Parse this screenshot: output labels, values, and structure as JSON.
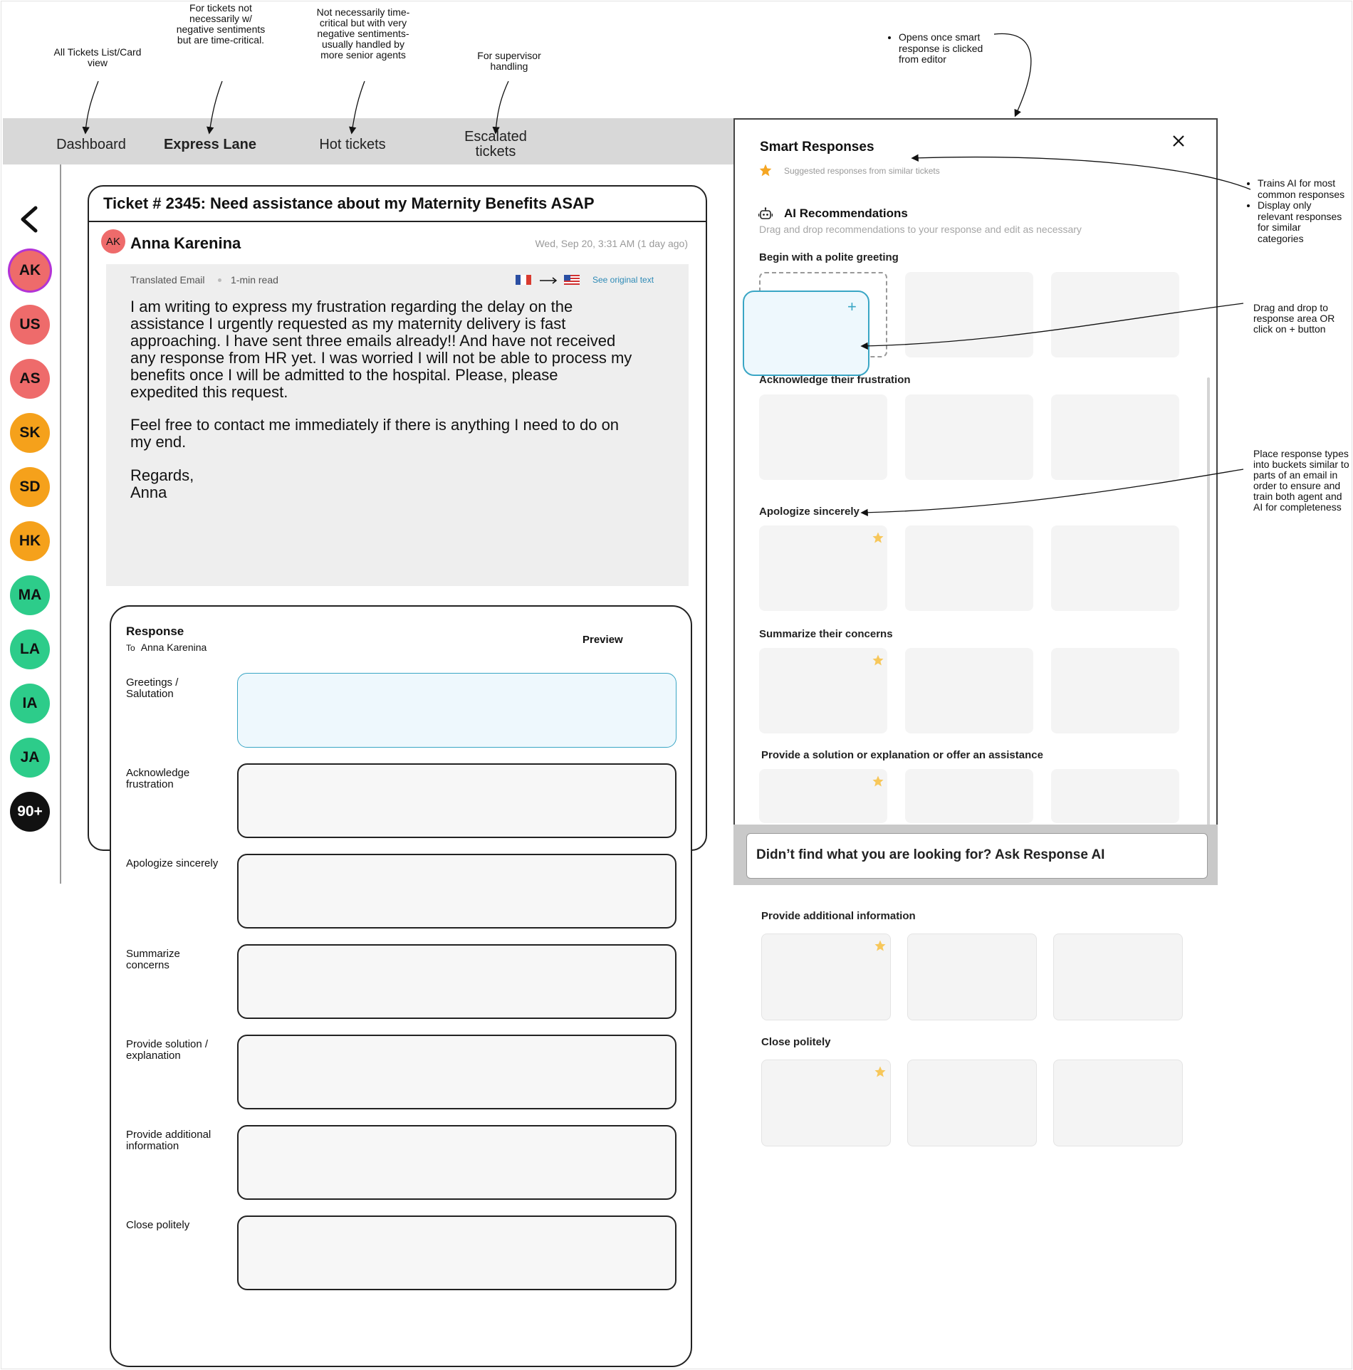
{
  "annotations": {
    "all_tickets": "All Tickets List/Card view",
    "express": "For tickets not necessarily w/ negative sentiments but are time-critical.",
    "hot": "Not necessarily time-critical but with very negative sentiments-usually handled by more senior agents",
    "escalated": "For supervisor handling",
    "opens": "Opens once smart response is clicked from editor",
    "trains": [
      "Trains AI for most common responses",
      "Display only relevant responses for similar categories"
    ],
    "drag": "Drag and drop to response area OR click on + button",
    "place": "Place response types into buckets similar to parts of an email in order to ensure and train both agent and AI for completeness"
  },
  "nav": {
    "dashboard": "Dashboard",
    "express_lane": "Express Lane",
    "hot_tickets": "Hot tickets",
    "escalated": "Escalated tickets"
  },
  "avatars": [
    {
      "initials": "AK",
      "color": "#ee6b6b"
    },
    {
      "initials": "US",
      "color": "#ee6b6b"
    },
    {
      "initials": "AS",
      "color": "#ee6b6b"
    },
    {
      "initials": "SK",
      "color": "#f5a11b"
    },
    {
      "initials": "SD",
      "color": "#f5a11b"
    },
    {
      "initials": "HK",
      "color": "#f5a11b"
    },
    {
      "initials": "MA",
      "color": "#2dcc8a"
    },
    {
      "initials": "LA",
      "color": "#2dcc8a"
    },
    {
      "initials": "IA",
      "color": "#2dcc8a"
    },
    {
      "initials": "JA",
      "color": "#2dcc8a"
    },
    {
      "initials": "90+",
      "color": "#111111"
    }
  ],
  "ticket": {
    "title": "Ticket # 2345: Need assistance about my Maternity Benefits ASAP",
    "sender_initials": "AK",
    "sender": "Anna Karenina",
    "timestamp": "Wed, Sep 20, 3:31 AM (1 day ago)",
    "translated": "Translated Email",
    "read_time": "1-min read",
    "see_original": "See original text",
    "paragraph1": "I am writing to express my frustration regarding the delay on the\nassistance I urgently requested as my maternity delivery is fast\napproaching. I have sent three emails already!! And have not received\nany response from HR yet. I was worried I will not be able to process my\nbenefits once I will be admitted to the hospital. Please, please\nexpedited this request.",
    "paragraph2": "Feel free to contact me immediately if there is anything I need to do on\nmy end.",
    "paragraph3": "Regards,\nAnna"
  },
  "response": {
    "title": "Response",
    "to_label": "To",
    "to_name": "Anna Karenina",
    "preview": "Preview",
    "slots": [
      "Greetings / Salutation",
      "Acknowledge frustration",
      "Apologize sincerely",
      "Summarize concerns",
      "Provide solution / explanation",
      "Provide additional information",
      "Close politely"
    ]
  },
  "smart": {
    "title": "Smart Responses",
    "suggested": "Suggested responses from similar tickets",
    "ai_title": "AI Recommendations",
    "ai_sub": "Drag and drop recommendations to your response and edit as necessary",
    "categories": [
      "Begin with a polite greeting",
      "Acknowledge their frustration",
      "Apologize sincerely",
      "Summarize their concerns",
      "Provide a solution or explanation or offer an assistance"
    ],
    "ask": "Didn’t find what you are looking for? Ask Response AI",
    "plus": "+",
    "extra_categories": [
      "Provide additional information",
      "Close politely"
    ]
  },
  "colors": {
    "accent": "#3aa6c5",
    "star": "#f5a623",
    "star_light": "#f7c75a",
    "nav_bg": "#d8d8d8"
  }
}
